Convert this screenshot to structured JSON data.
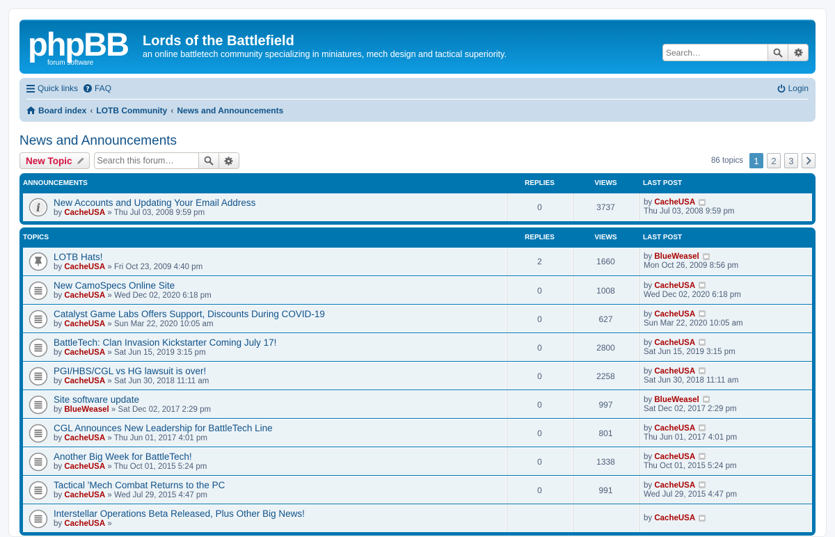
{
  "header": {
    "logo_text": "phpBB",
    "logo_sub": "forum software",
    "site_title": "Lords of the Battlefield",
    "site_desc": "an online battletech community specializing in miniatures, mech design and tactical superiority.",
    "search_placeholder": "Search…"
  },
  "navbar": {
    "quick_links": "Quick links",
    "faq": "FAQ",
    "login": "Login",
    "breadcrumbs": [
      "Board index",
      "LOTB Community",
      "News and Announcements"
    ]
  },
  "forum": {
    "title": "News and Announcements",
    "new_topic": "New Topic",
    "search_placeholder": "Search this forum…",
    "topic_count": "86 topics",
    "pages": [
      "1",
      "2",
      "3"
    ]
  },
  "columns": {
    "replies": "REPLIES",
    "views": "VIEWS",
    "last_post": "LAST POST"
  },
  "announcements": {
    "heading": "ANNOUNCEMENTS",
    "rows": [
      {
        "title": "New Accounts and Updating Your Email Address",
        "author": "CacheUSA",
        "date": "Thu Jul 03, 2008 9:59 pm",
        "replies": "0",
        "views": "3737",
        "last_author": "CacheUSA",
        "last_date": "Thu Jul 03, 2008 9:59 pm"
      }
    ]
  },
  "topics": {
    "heading": "TOPICS",
    "rows": [
      {
        "title": "LOTB Hats!",
        "author": "CacheUSA",
        "date": "Fri Oct 23, 2009 4:40 pm",
        "replies": "2",
        "views": "1660",
        "last_author": "BlueWeasel",
        "last_date": "Mon Oct 26, 2009 8:56 pm",
        "icon": "sticky"
      },
      {
        "title": "New CamoSpecs Online Site",
        "author": "CacheUSA",
        "date": "Wed Dec 02, 2020 6:18 pm",
        "replies": "0",
        "views": "1008",
        "last_author": "CacheUSA",
        "last_date": "Wed Dec 02, 2020 6:18 pm",
        "icon": "topic"
      },
      {
        "title": "Catalyst Game Labs Offers Support, Discounts During COVID-19",
        "author": "CacheUSA",
        "date": "Sun Mar 22, 2020 10:05 am",
        "replies": "0",
        "views": "627",
        "last_author": "CacheUSA",
        "last_date": "Sun Mar 22, 2020 10:05 am",
        "icon": "topic"
      },
      {
        "title": "BattleTech: Clan Invasion Kickstarter Coming July 17!",
        "author": "CacheUSA",
        "date": "Sat Jun 15, 2019 3:15 pm",
        "replies": "0",
        "views": "2800",
        "last_author": "CacheUSA",
        "last_date": "Sat Jun 15, 2019 3:15 pm",
        "icon": "topic"
      },
      {
        "title": "PGI/HBS/CGL vs HG lawsuit is over!",
        "author": "CacheUSA",
        "date": "Sat Jun 30, 2018 11:11 am",
        "replies": "0",
        "views": "2258",
        "last_author": "CacheUSA",
        "last_date": "Sat Jun 30, 2018 11:11 am",
        "icon": "topic"
      },
      {
        "title": "Site software update",
        "author": "BlueWeasel",
        "date": "Sat Dec 02, 2017 2:29 pm",
        "replies": "0",
        "views": "997",
        "last_author": "BlueWeasel",
        "last_date": "Sat Dec 02, 2017 2:29 pm",
        "icon": "topic"
      },
      {
        "title": "CGL Announces New Leadership for BattleTech Line",
        "author": "CacheUSA",
        "date": "Thu Jun 01, 2017 4:01 pm",
        "replies": "0",
        "views": "801",
        "last_author": "CacheUSA",
        "last_date": "Thu Jun 01, 2017 4:01 pm",
        "icon": "topic"
      },
      {
        "title": "Another Big Week for BattleTech!",
        "author": "CacheUSA",
        "date": "Thu Oct 01, 2015 5:24 pm",
        "replies": "0",
        "views": "1338",
        "last_author": "CacheUSA",
        "last_date": "Thu Oct 01, 2015 5:24 pm",
        "icon": "topic"
      },
      {
        "title": "Tactical 'Mech Combat Returns to the PC",
        "author": "CacheUSA",
        "date": "Wed Jul 29, 2015 4:47 pm",
        "replies": "0",
        "views": "991",
        "last_author": "CacheUSA",
        "last_date": "Wed Jul 29, 2015 4:47 pm",
        "icon": "topic"
      },
      {
        "title": "Interstellar Operations Beta Released, Plus Other Big News!",
        "author": "CacheUSA",
        "date": "",
        "replies": "",
        "views": "",
        "last_author": "CacheUSA",
        "last_date": "",
        "icon": "topic"
      }
    ]
  },
  "colors": {
    "brand_blue": "#0076b1",
    "link": "#105289",
    "author_red": "#aa0000",
    "row_bg": "#ecf3f7",
    "navbar_bg": "#cadceb"
  }
}
